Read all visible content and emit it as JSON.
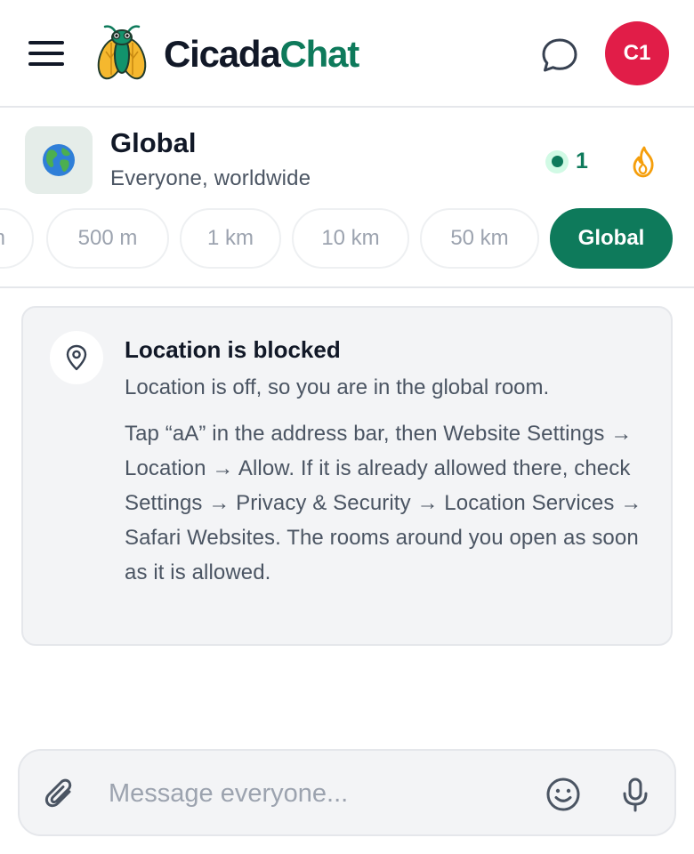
{
  "app": {
    "brand_part1": "Cicada",
    "brand_part2": "Chat",
    "brand_color": "#0e7a5b",
    "avatar_initials": "C1",
    "avatar_color": "#e11d48"
  },
  "icons": {
    "menu": "hamburger-menu-icon",
    "logo": "cicada-logo-icon",
    "chat": "chat-bubble-icon",
    "room": "globe-icon",
    "online": "online-dot-icon",
    "trending": "flame-icon",
    "location": "map-pin-icon",
    "attach": "paperclip-icon",
    "emoji": "smiley-icon",
    "voice": "microphone-icon"
  },
  "room": {
    "title": "Global",
    "subtitle": "Everyone, worldwide",
    "online_count": "1"
  },
  "radius_chips": [
    {
      "label": "m",
      "active": false
    },
    {
      "label": "500 m",
      "active": false
    },
    {
      "label": "1 km",
      "active": false
    },
    {
      "label": "10 km",
      "active": false
    },
    {
      "label": "50 km",
      "active": false
    },
    {
      "label": "Global",
      "active": true
    }
  ],
  "notice": {
    "title": "Location is blocked",
    "subtitle": "Location is off, so you are in the global room.",
    "body": "Tap “aA” in the address bar, then Website Settings → Location → Allow. If it is already allowed there, check Settings → Privacy & Security → Location Services → Safari Websites. The rooms around you open as soon as it is allowed."
  },
  "composer": {
    "placeholder": "Message everyone..."
  }
}
